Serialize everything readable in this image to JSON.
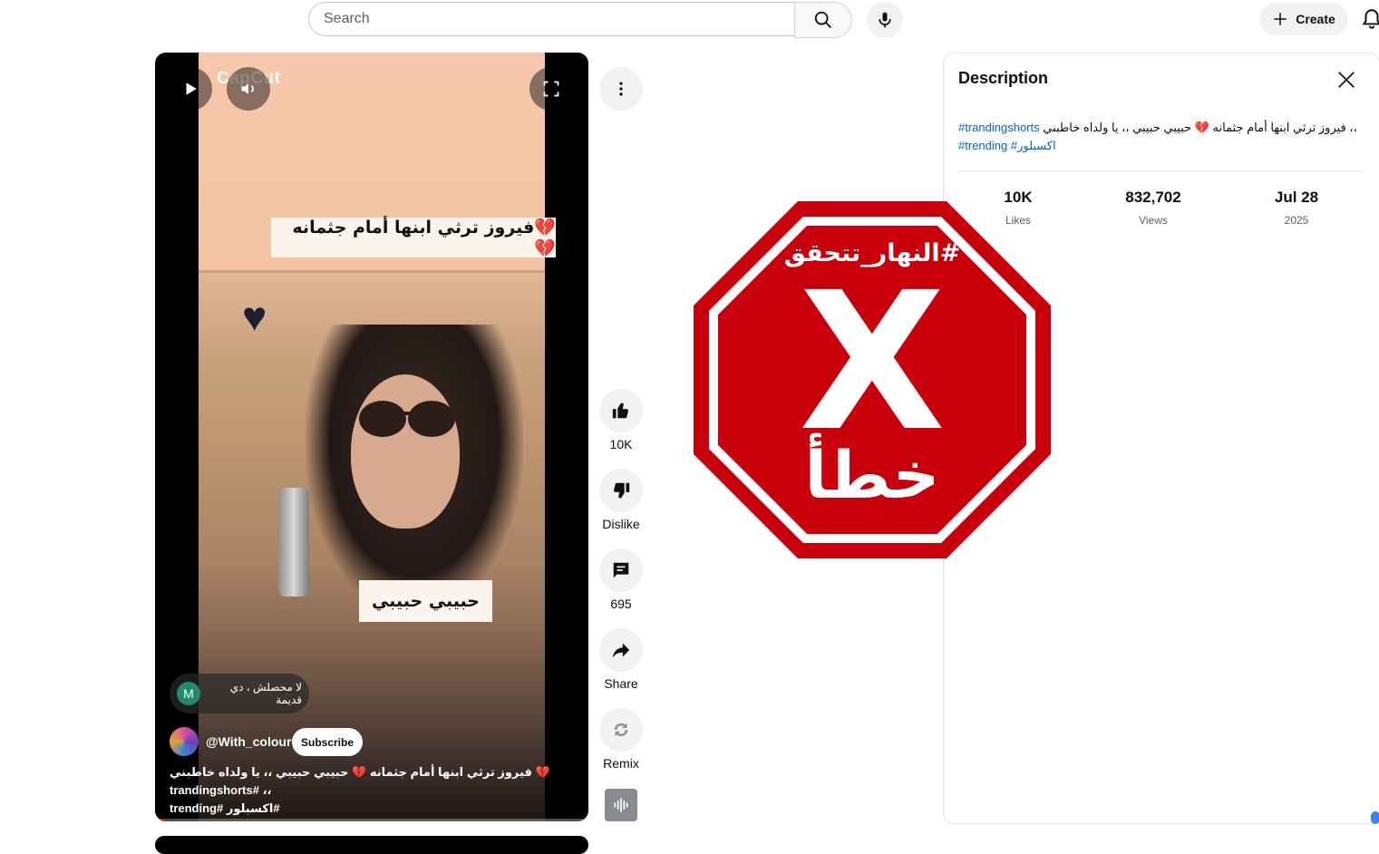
{
  "topbar": {
    "search_placeholder": "Search",
    "create_label": "Create"
  },
  "video": {
    "watermark": "CapCut",
    "caption_top": "💔فيروز ترثي ابنها أمام جثمانه💔",
    "caption_mid": "حبيبي حبيبي",
    "pinned_comment_avatar": "M",
    "pinned_comment": "لا محصلش ، دي قديمة",
    "channel": "@With_colour",
    "subscribe_label": "Subscribe",
    "title_line1": "💔 فيروز ترثي ابنها أمام جثمانه 💔 حبيبي حبيبي ،، يا ولداه خاطبني ،، #trandingshorts",
    "title_line2": "#اكسبلور #trending",
    "progress": 0.02
  },
  "actions": {
    "likes": "10K",
    "dislike_label": "Dislike",
    "comments": "695",
    "share_label": "Share",
    "remix_label": "Remix"
  },
  "overlay": {
    "hashtag": "#النهار_تتحقق",
    "mark": "X",
    "verdict": "خطأ",
    "color": "#c8000b"
  },
  "description_panel": {
    "title": "Description",
    "text_tag1": "#trandingshorts",
    "text_body": "فيروز ترثي ابنها أمام جثمانه 💔 حبيبي حبيبي ،، يا ولداه خاطبني ،،",
    "text_tag2": "#trending",
    "text_tag3": "#اكسبلور",
    "stats": [
      {
        "value": "10K",
        "label": "Likes"
      },
      {
        "value": "832,702",
        "label": "Views"
      },
      {
        "value": "Jul 28",
        "label": "2025"
      }
    ]
  }
}
